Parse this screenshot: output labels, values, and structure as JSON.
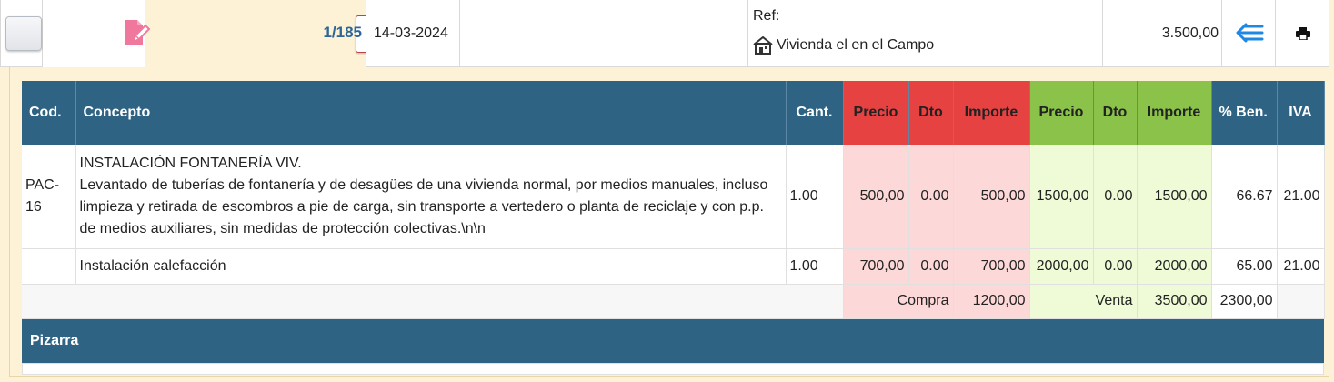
{
  "header": {
    "record_number": "1/185",
    "date": "14-03-2024",
    "ref_label": "Ref:",
    "property_name": "Vivienda el en el Campo",
    "amount": "3.500,00",
    "delete_symbol": "✖",
    "icons": {
      "checkbox": "checkbox-button",
      "edit": "edit-document-icon",
      "delete": "close-icon",
      "property": "building-icon",
      "back": "back-list-icon",
      "print": "printer-icon"
    },
    "colors": {
      "accent": "#2d6598",
      "edit_icon": "#f0789c",
      "delete": "#d42525",
      "back_icon": "#1e88e5"
    }
  },
  "table": {
    "headers": {
      "cod": "Cod.",
      "concepto": "Concepto",
      "cant": "Cant.",
      "precio_compra": "Precio",
      "dto_compra": "Dto",
      "importe_compra": "Importe",
      "precio_venta": "Precio",
      "dto_venta": "Dto",
      "importe_venta": "Importe",
      "ben": "% Ben.",
      "iva": "IVA"
    },
    "rows": [
      {
        "cod": "PAC-16",
        "concepto_title": "INSTALACIÓN FONTANERÍA VIV.",
        "concepto_desc": "Levantado de tuberías de fontanería y de desagües de una vivienda normal, por medios manuales, incluso limpieza y retirada de escombros a pie de carga, sin transporte a vertedero o planta de reciclaje y con p.p. de medios auxiliares, sin medidas de protección colectivas.\\n\\n",
        "cant": "1.00",
        "precio_compra": "500,00",
        "dto_compra": "0.00",
        "importe_compra": "500,00",
        "precio_venta": "1500,00",
        "dto_venta": "0.00",
        "importe_venta": "1500,00",
        "ben": "66.67",
        "iva": "21.00"
      },
      {
        "cod": "",
        "concepto_title": "Instalación calefacción",
        "cant": "1.00",
        "precio_compra": "700,00",
        "dto_compra": "0.00",
        "importe_compra": "700,00",
        "precio_venta": "2000,00",
        "dto_venta": "0.00",
        "importe_venta": "2000,00",
        "ben": "65.00",
        "iva": "21.00"
      }
    ],
    "totals": {
      "compra_label": "Compra",
      "compra_total": "1200,00",
      "venta_label": "Venta",
      "venta_total": "3500,00",
      "ben_total": "2300,00"
    },
    "colors": {
      "header": "#2f6384",
      "compra_header": "#e64242",
      "compra_cell": "#fdd8d8",
      "venta_header": "#8bc34a",
      "venta_cell": "#eefbd6"
    }
  },
  "pizarra": {
    "title": "Pizarra"
  }
}
